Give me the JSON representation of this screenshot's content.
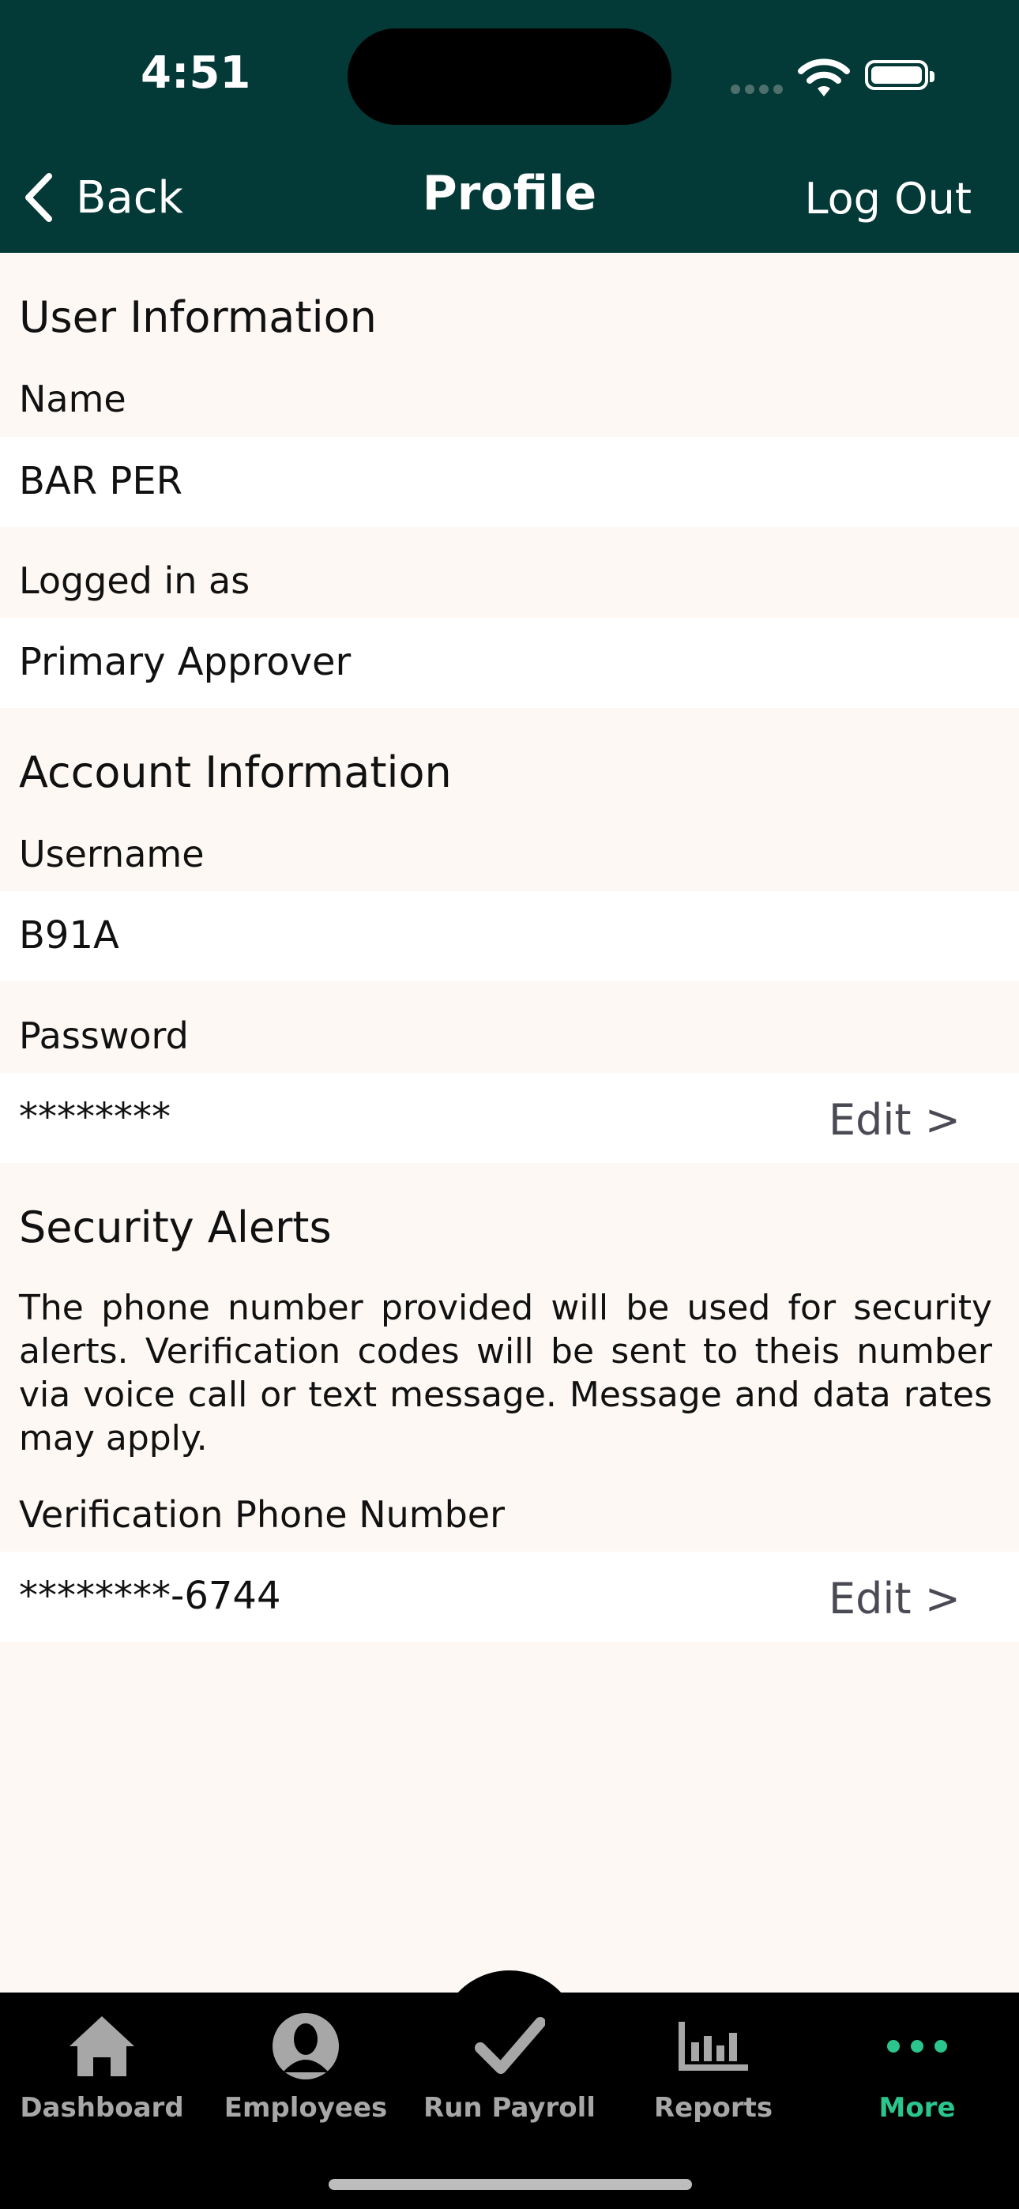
{
  "status_bar": {
    "time": "4:51"
  },
  "nav": {
    "back_label": "Back",
    "title": "Profile",
    "logout_label": "Log Out"
  },
  "user_info": {
    "heading": "User Information",
    "name_label": "Name",
    "name_value": "BAR PER",
    "role_label": "Logged in as",
    "role_value": "Primary Approver"
  },
  "account_info": {
    "heading": "Account Information",
    "username_label": "Username",
    "username_value": "B91A",
    "password_label": "Password",
    "password_value": "********",
    "password_edit": "Edit >"
  },
  "security": {
    "heading": "Security Alerts",
    "description": "The phone number provided will be used for security alerts. Verification codes will be sent to theis number via voice call or text message. Message and data rates may apply.",
    "phone_label": "Verification Phone Number",
    "phone_value": "********-6744",
    "phone_edit": "Edit >"
  },
  "tabs": [
    {
      "label": "Dashboard",
      "icon": "home-icon",
      "active": false
    },
    {
      "label": "Employees",
      "icon": "person-icon",
      "active": false
    },
    {
      "label": "Run Payroll",
      "icon": "checkmark-icon",
      "active": false
    },
    {
      "label": "Reports",
      "icon": "bar-chart-icon",
      "active": false
    },
    {
      "label": "More",
      "icon": "more-icon",
      "active": true
    }
  ],
  "colors": {
    "header_bg": "#033a37",
    "accent": "#2ac68e",
    "page_bg": "#fdf8f3"
  }
}
